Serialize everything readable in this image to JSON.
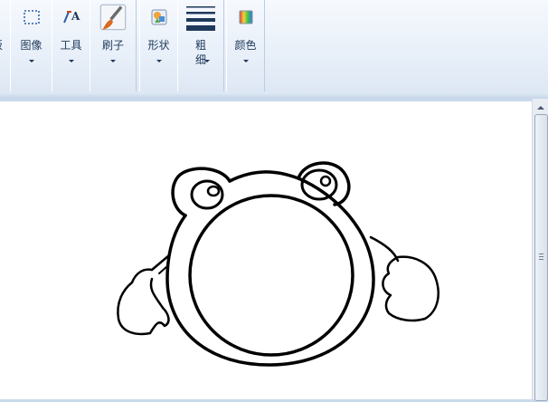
{
  "ribbon": {
    "groups": [
      {
        "label": "板"
      },
      {
        "label": "图像"
      },
      {
        "label": "工具"
      },
      {
        "label": "刷子"
      },
      {
        "label": "形状"
      },
      {
        "label": "粗\n细"
      },
      {
        "label": "颜色"
      }
    ]
  },
  "icons": {
    "image": "select-rect-icon",
    "tools": "tools-icon",
    "brushes": "brush-icon",
    "shapes": "shapes-icon",
    "size": "line-size-icon",
    "colors": "color-picker-icon"
  },
  "colors": {
    "ribbon_text": "#1e395b",
    "stroke": "#000000",
    "canvas": "#ffffff",
    "workspace": "#c9d9ec"
  }
}
